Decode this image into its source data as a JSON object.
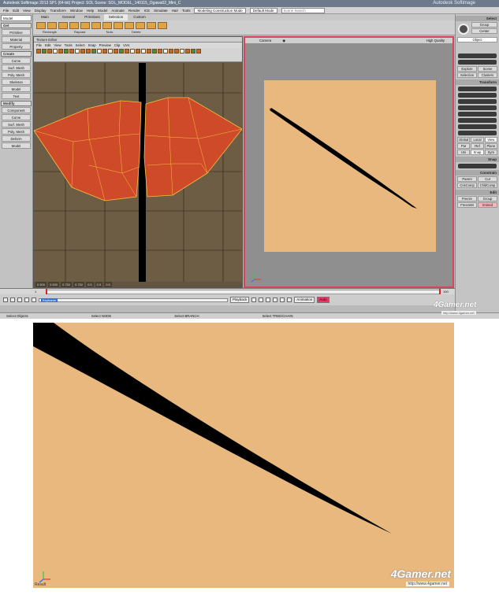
{
  "app": {
    "title": "Autodesk Softimage 2013 SP1 (64-bit)   Project: SOL   Scene: SOL_MODEL_140115_Ogawa02_Mini_C",
    "brand": "Autodesk Softimage",
    "menus": [
      "File",
      "Edit",
      "View",
      "Display",
      "Transform",
      "Window",
      "Help",
      "Model",
      "Animate",
      "Render",
      "ICE",
      "Simulate",
      "Hair",
      "Tools"
    ],
    "layout_dropdown": "Modeling Construction Mode",
    "preset_dropdown": "Default Mode",
    "search_placeholder": "Scene Search",
    "main_tabs": [
      "Main",
      "General",
      "Primitives",
      "Selection",
      "Custom"
    ],
    "toolstrip_captions": [
      "Rectangle",
      "Raycast",
      "Tools",
      "Delete"
    ]
  },
  "leftbar": {
    "mode": "Model",
    "sections": [
      {
        "name": "Get",
        "items": [
          "Primitive",
          "Material",
          "Property"
        ]
      },
      {
        "name": "Create",
        "items": [
          "Curve",
          "Surf. Mesh",
          "Poly. Mesh",
          "Skeleton",
          "Model",
          "Text"
        ]
      },
      {
        "name": "Modify",
        "items": [
          "Component",
          "Curve",
          "Surf. Mesh",
          "Poly. Mesh",
          "Deform",
          "Model"
        ]
      }
    ]
  },
  "texture_editor": {
    "title": "Texture Editor",
    "menus": [
      "File",
      "Edit",
      "View",
      "Tools",
      "Select",
      "Snap",
      "Preview",
      "Clip",
      "UVs"
    ],
    "footer_values": [
      "0.500",
      "0.500",
      "0.752",
      "0.752",
      "0.5",
      "0.5",
      "0.5"
    ]
  },
  "camera_view": {
    "title": "Camera",
    "hq_label": "High Quality"
  },
  "rightpanel": {
    "header": "Select",
    "top_buttons": [
      "Group",
      "Center"
    ],
    "object_label": "Object",
    "mid_buttons": [
      "Explore",
      "Scene"
    ],
    "sel_buttons": [
      "Selection",
      "Clusters"
    ],
    "transform_header": "Transform",
    "mode_buttons": [
      "Global",
      "Local",
      "View"
    ],
    "ref_buttons": [
      "Par",
      "Ref",
      "Plane"
    ],
    "edit_buttons": [
      "Uni",
      "Snap",
      "Sym"
    ],
    "snap_header": "Snap",
    "constrain_header": "Constrain",
    "constrain_buttons": [
      "Parent",
      "Cut",
      "CnsComp",
      "ChldComp"
    ],
    "edit_header": "Edit",
    "edit_list": [
      "Freeze",
      "Group",
      "FreezeM",
      "Immed"
    ]
  },
  "timeline": {
    "start": "1",
    "end": "100",
    "current_frame": "1"
  },
  "transport": {
    "slider_label": "Keyframe",
    "playback_label": "Playback",
    "anim_label": "Animation",
    "auto_label": "Auto"
  },
  "statusbar": {
    "left": "Select Objects",
    "mid1": "Select NODE",
    "mid2": "Select BRANCH",
    "right": "Select TREE/CHAIN"
  },
  "watermark": {
    "brand": "4Gamer.net",
    "url": "http://www.4gamer.net"
  },
  "render_view": {
    "status": "Result"
  },
  "colors": {
    "skin": "#e8b87e",
    "uv_shell": "#cf4a28",
    "uv_edge": "#f6c040",
    "uv_bg": "#6e5d45",
    "viewport_border": "#d9435c"
  }
}
